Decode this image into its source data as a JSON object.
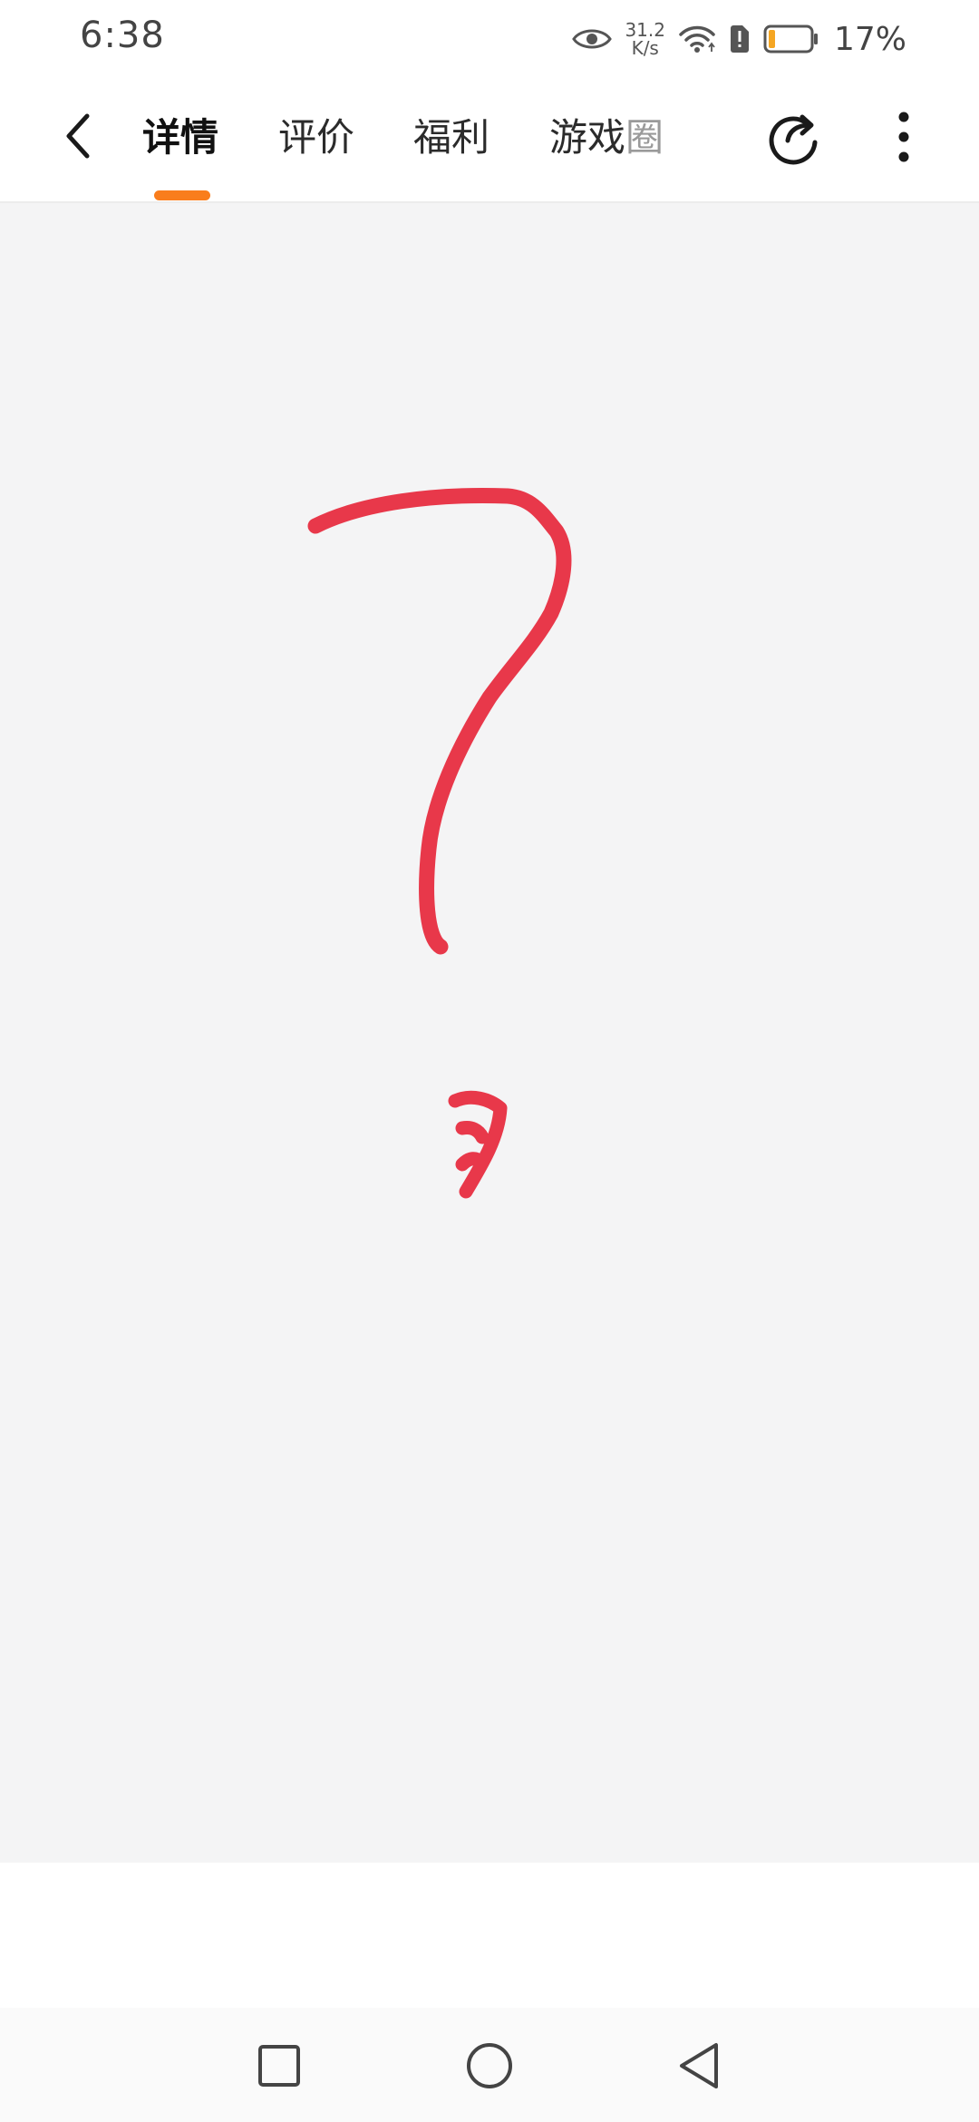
{
  "status_bar": {
    "time": "6:38",
    "net_speed_value": "31.2",
    "net_speed_unit": "K/s",
    "battery_percent": "17%",
    "battery_level": 0.17,
    "battery_color": "#f5a623",
    "icons": [
      "eye-icon",
      "wifi-icon",
      "sim-alert-icon",
      "battery-icon"
    ]
  },
  "nav": {
    "tabs": [
      {
        "label": "详情",
        "active": true
      },
      {
        "label": "评价",
        "active": false
      },
      {
        "label": "福利",
        "active": false
      },
      {
        "label": "游戏",
        "active": false,
        "faded_suffix": "圈"
      }
    ],
    "accent_color": "#f97d1c",
    "icons": [
      "back-arrow-icon",
      "share-icon",
      "more-vertical-icon"
    ]
  },
  "content": {
    "background": "#f4f4f5",
    "drawing": "hand-drawn red question mark",
    "stroke_color": "#e8384a"
  },
  "system_nav": {
    "icons": [
      "recent-apps-icon",
      "home-icon",
      "back-triangle-icon"
    ]
  }
}
